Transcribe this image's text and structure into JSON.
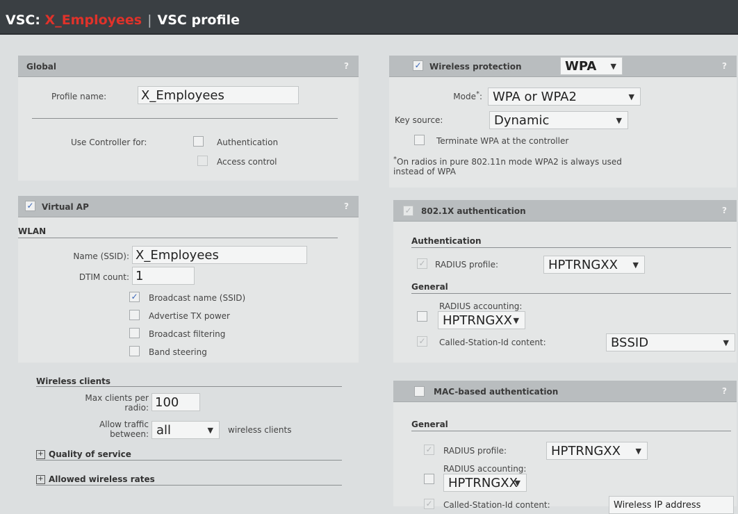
{
  "header": {
    "vsc_prefix": "VSC: ",
    "vsc_name": "X_Employees",
    "separator": "|",
    "page": "VSC profile"
  },
  "global": {
    "title": "Global",
    "help": "?",
    "profile_name_label": "Profile name:",
    "profile_name_value": "X_Employees",
    "use_controller_label": "Use Controller for:",
    "authentication_label": "Authentication",
    "access_control_label": "Access control"
  },
  "virtual_ap": {
    "title": "Virtual AP",
    "help": "?",
    "wlan_heading": "WLAN",
    "name_label": "Name (SSID):",
    "name_value": "X_Employees",
    "dtim_label": "DTIM count:",
    "dtim_value": "1",
    "broadcast_name": "Broadcast name (SSID)",
    "advertise_tx": "Advertise TX power",
    "broadcast_filtering": "Broadcast filtering",
    "band_steering": "Band steering"
  },
  "wireless_clients": {
    "heading": "Wireless clients",
    "max_clients_label": [
      "Max clients per",
      "radio:"
    ],
    "max_clients_value": "100",
    "allow_traffic_label": [
      "Allow traffic",
      "between:"
    ],
    "allow_traffic_value": "all",
    "allow_traffic_suffix": "wireless clients",
    "qos": "Quality of service",
    "allowed_rates": "Allowed wireless rates",
    "expand_symbol": "+"
  },
  "wireless_protection": {
    "title": "Wireless protection",
    "value": "WPA",
    "help": "?",
    "mode_label": "Mode",
    "mode_star": "*",
    "mode_colon": ":",
    "mode_value": "WPA or WPA2",
    "key_source_label": "Key source:",
    "key_source_value": "Dynamic",
    "terminate_label": "Terminate WPA at the controller",
    "note_line1": "On radios in pure 802.11n mode WPA2 is always used",
    "note_line2": "instead of WPA",
    "note_star": "*"
  },
  "dot1x": {
    "title": "802.1X authentication",
    "help": "?",
    "auth_heading": "Authentication",
    "radius_profile_label": "RADIUS profile:",
    "radius_profile_value": "HPTRNGXX",
    "general_heading": "General",
    "radius_accounting_label": "RADIUS accounting:",
    "radius_accounting_value": "HPTRNGXX",
    "called_station_label": "Called-Station-Id content:",
    "called_station_value": "BSSID"
  },
  "mac_auth": {
    "title": "MAC-based authentication",
    "help": "?",
    "general_heading": "General",
    "radius_profile_label": "RADIUS profile:",
    "radius_profile_value": "HPTRNGXX",
    "radius_accounting_label": "RADIUS accounting:",
    "radius_accounting_value": "HPTRNGXX",
    "called_station_label": "Called-Station-Id content:",
    "called_station_value": "Wireless IP address"
  },
  "glyphs": {
    "check": "✓",
    "caret": "▼"
  },
  "theme": {
    "accent": "#e0322a",
    "header_bg": "#3a3f43",
    "panel_header": "#b9bdbf",
    "panel_bg": "#e4e6e6",
    "check_color": "#3b67b8"
  }
}
